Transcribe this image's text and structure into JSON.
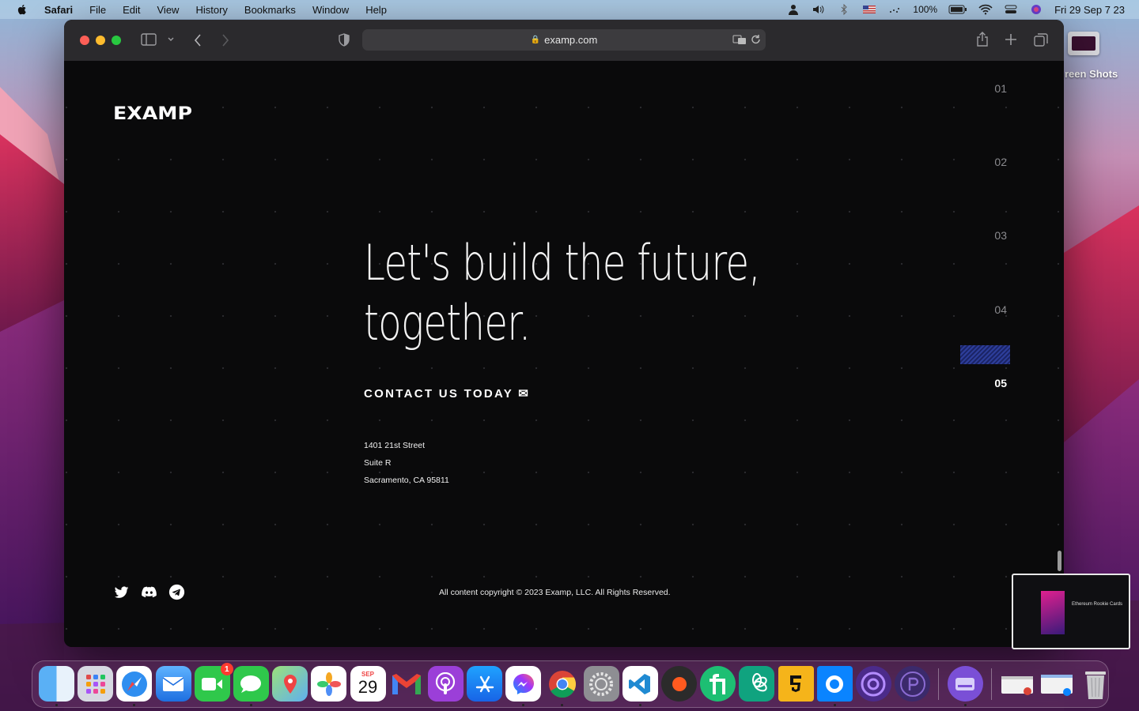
{
  "menubar": {
    "app": "Safari",
    "items": [
      "File",
      "Edit",
      "View",
      "History",
      "Bookmarks",
      "Window",
      "Help"
    ],
    "battery": "100%",
    "datetime": "Fri 29 Sep  7 23"
  },
  "browser": {
    "url": "examp.com"
  },
  "page": {
    "logo_text": "EXAMP",
    "headline_line1": "Let's build the future,",
    "headline_line2": "together.",
    "contact_label": "CONTACT US TODAY ✉",
    "address": [
      "1401 21st Street",
      "Suite R",
      "Sacramento, CA 95811"
    ],
    "steps": [
      "01",
      "02",
      "03",
      "04",
      "05"
    ],
    "active_step": "05",
    "socials": [
      "twitter-icon",
      "discord-icon",
      "telegram-icon"
    ],
    "copyright": "All content copyright © 2023 Examp, LLC. All Rights Reserved."
  },
  "desktop": {
    "folder_label": "reen Shots",
    "thumbnail_text": "Ethereum Rookie Cards"
  },
  "dock": {
    "calendar_month": "SEP",
    "calendar_day": "29",
    "facetime_badge": "1",
    "apps": [
      "finder",
      "launchpad",
      "safari",
      "mail",
      "facetime",
      "messages",
      "maps",
      "photos",
      "calendar",
      "gmail",
      "podcasts",
      "app-store",
      "messenger",
      "chrome",
      "system-preferences",
      "vscode",
      "recorder",
      "fiverr",
      "chatgpt",
      "html5",
      "screen-recorder",
      "proxyman",
      "pockets",
      "disk-utility",
      "documents",
      "windows",
      "trash"
    ]
  }
}
